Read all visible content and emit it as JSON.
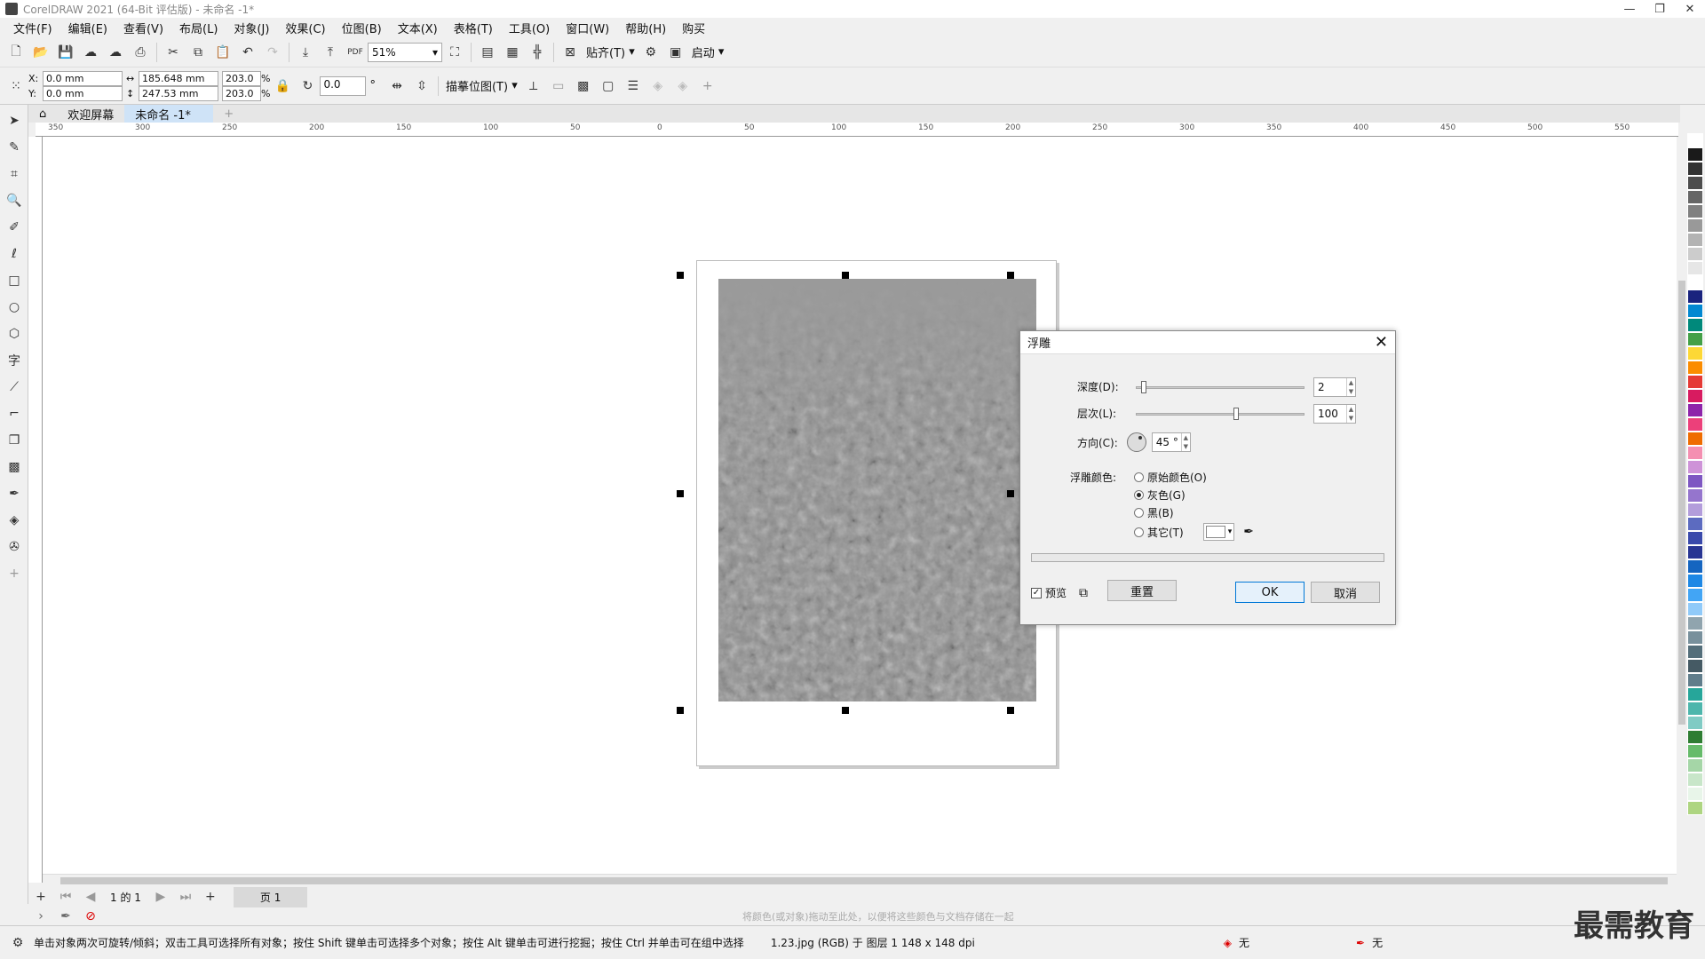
{
  "window": {
    "title": "CorelDRAW 2021 (64-Bit 评估版) - 未命名 -1*",
    "min": "—",
    "max": "❐",
    "close": "✕"
  },
  "menu": [
    "文件(F)",
    "编辑(E)",
    "查看(V)",
    "布局(L)",
    "对象(J)",
    "效果(C)",
    "位图(B)",
    "文本(X)",
    "表格(T)",
    "工具(O)",
    "窗口(W)",
    "帮助(H)",
    "购买"
  ],
  "toolbar": {
    "zoom": "51%",
    "snap_label": "贴齐(T)",
    "launch_label": "启动"
  },
  "propbar": {
    "x_label": "X:",
    "x_value": "0.0 mm",
    "y_label": "Y:",
    "y_value": "0.0 mm",
    "w_value": "185.648 mm",
    "h_value": "247.53 mm",
    "sx": "203.0",
    "sy": "203.0",
    "pct": "%",
    "rotation": "0.0",
    "deg": "°",
    "trace_label": "描摹位图(T)"
  },
  "tabs": {
    "home": "欢迎屏幕",
    "doc": "未命名 -1*",
    "add": "+"
  },
  "ruler_h": [
    "350",
    "300",
    "250",
    "200",
    "150",
    "100",
    "50",
    "0",
    "50",
    "100",
    "150",
    "200",
    "250",
    "300",
    "350",
    "400",
    "450",
    "500",
    "550"
  ],
  "dialog": {
    "title": "浮雕",
    "depth_label": "深度(D):",
    "depth_value": "2",
    "depth_level": 0.03,
    "level_label": "层次(L):",
    "level_value": "100",
    "level_level": 0.6,
    "direction_label": "方向(C):",
    "direction_value": "45 °",
    "color_label": "浮雕颜色:",
    "options": [
      {
        "label": "原始颜色(O)",
        "checked": false
      },
      {
        "label": "灰色(G)",
        "checked": true
      },
      {
        "label": "黑(B)",
        "checked": false
      },
      {
        "label": "其它(T)",
        "checked": false
      }
    ],
    "preview_label": "预览",
    "reset_label": "重置",
    "ok_label": "OK",
    "cancel_label": "取消"
  },
  "pagenav": {
    "page_count": "1 的 1",
    "page_tab": "页 1"
  },
  "colorbar_hint": "将颜色(或对象)拖动至此处，以便将这些颜色与文档存储在一起",
  "status": {
    "hint": "单击对象两次可旋转/倾斜；双击工具可选择所有对象；按住 Shift 键单击可选择多个对象；按住 Alt 键单击可进行挖掘；按住 Ctrl 并单击可在组中选择",
    "info": "1.23.jpg (RGB) 于 图层 1 148 x 148 dpi",
    "fill": "无",
    "outline": "无"
  },
  "watermark": "最需教育",
  "palette": [
    "#ffffff",
    "#1a1a1a",
    "#333333",
    "#4d4d4d",
    "#666666",
    "#808080",
    "#999999",
    "#b3b3b3",
    "#cccccc",
    "#e6e6e6",
    "#ffffff",
    "#1a237e",
    "#0288d1",
    "#00897b",
    "#43a047",
    "#fdd835",
    "#fb8c00",
    "#e53935",
    "#d81b60",
    "#8e24aa",
    "#ec407a",
    "#ef6c00",
    "#f48fb1",
    "#ce93d8",
    "#7e57c2",
    "#9575cd",
    "#b39ddb",
    "#5c6bc0",
    "#3949ab",
    "#283593",
    "#1565c0",
    "#1e88e5",
    "#42a5f5",
    "#90caf9",
    "#90a4ae",
    "#78909c",
    "#546e7a",
    "#455a64",
    "#607d8b",
    "#26a69a",
    "#4db6ac",
    "#80cbc4",
    "#2e7d32",
    "#66bb6a",
    "#a5d6a7",
    "#c8e6c9",
    "#e8f5e9",
    "#aed581"
  ]
}
